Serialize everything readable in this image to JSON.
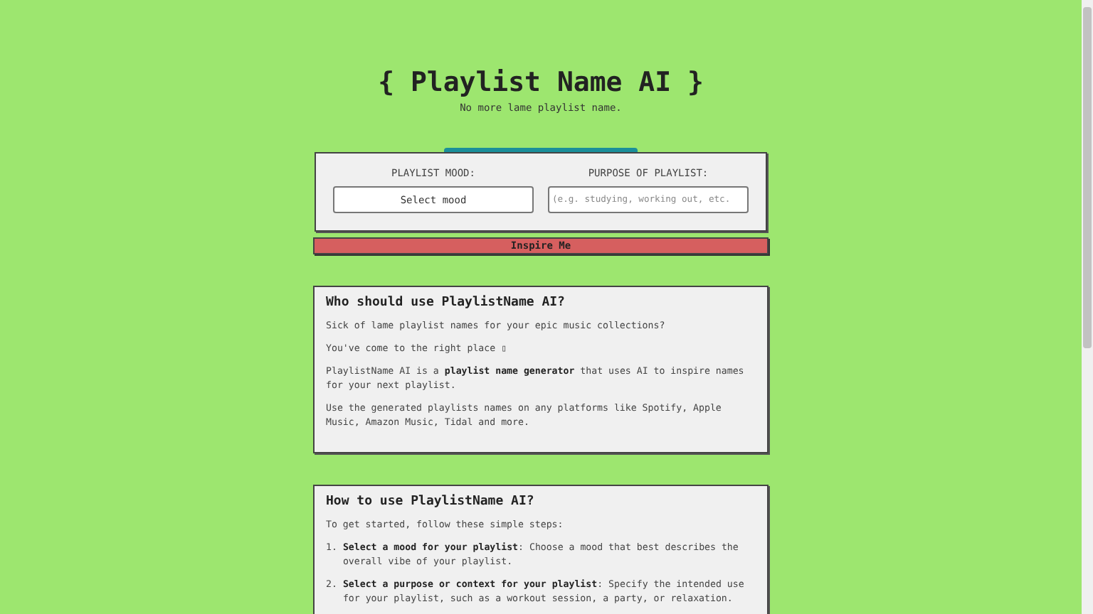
{
  "header": {
    "title": "{ Playlist Name AI }",
    "subtitle": "No more lame playlist name."
  },
  "form": {
    "mood": {
      "label": "PLAYLIST MOOD:",
      "value": "Select mood"
    },
    "purpose": {
      "label": "PURPOSE OF PLAYLIST:",
      "placeholder": "(e.g. studying, working out, etc."
    },
    "submit": "Inspire Me"
  },
  "sections": [
    {
      "heading": "Who should use PlaylistName AI?",
      "paragraphs": [
        "Sick of lame playlist names for your epic music collections?",
        "You've come to the right place ▯",
        "PlaylistName AI is a **playlist name generator** that uses AI to inspire names for your next playlist.",
        "Use the generated playlists names on any platforms like Spotify, Apple Music, Amazon Music, Tidal and more."
      ]
    },
    {
      "heading": "How to use PlaylistName AI?",
      "paragraphs": [
        "To get started, follow these simple steps:"
      ],
      "steps": [
        {
          "number": "1.",
          "text": "**Select a mood for your playlist**: Choose a mood that best describes the overall vibe of your playlist."
        },
        {
          "number": "2.",
          "text": "**Select a purpose or context for your playlist**: Specify the intended use for your playlist, such as a workout session, a party, or relaxation."
        }
      ]
    }
  ]
}
